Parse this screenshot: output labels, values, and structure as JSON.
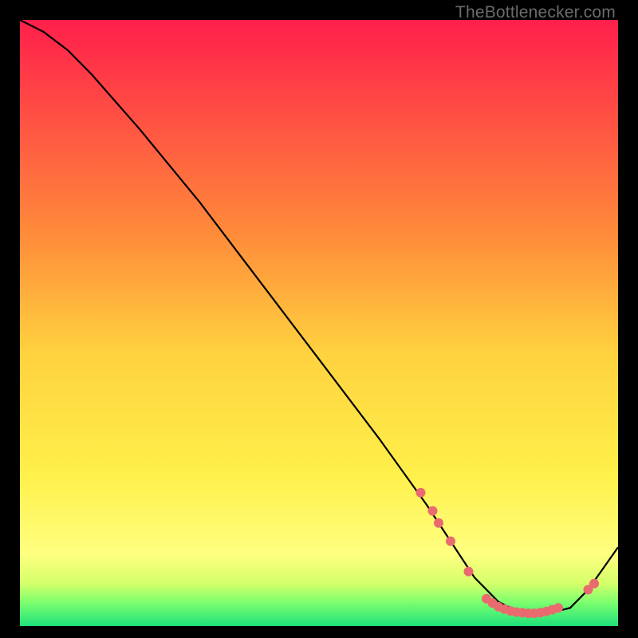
{
  "watermark": "TheBottlenecker.com",
  "chart_data": {
    "type": "line",
    "title": "",
    "xlabel": "",
    "ylabel": "",
    "xlim": [
      0,
      100
    ],
    "ylim": [
      0,
      100
    ],
    "grid": false,
    "background_gradient": {
      "stops": [
        {
          "offset": 0,
          "color": "#ff1f4b"
        },
        {
          "offset": 35,
          "color": "#ff8a3a"
        },
        {
          "offset": 55,
          "color": "#ffd23f"
        },
        {
          "offset": 75,
          "color": "#fff04a"
        },
        {
          "offset": 88,
          "color": "#ffff80"
        },
        {
          "offset": 93,
          "color": "#d4ff6a"
        },
        {
          "offset": 96,
          "color": "#7fff6e"
        },
        {
          "offset": 100,
          "color": "#1de27a"
        }
      ]
    },
    "series": [
      {
        "name": "bottleneck-curve",
        "x": [
          0,
          4,
          8,
          12,
          20,
          30,
          40,
          50,
          60,
          68,
          72,
          76,
          80,
          84,
          88,
          92,
          95,
          100
        ],
        "y": [
          100,
          98,
          95,
          91,
          82,
          70,
          57,
          44,
          31,
          20,
          14,
          8,
          4,
          2,
          2,
          3,
          6,
          13
        ]
      }
    ],
    "markers": {
      "name": "highlight-dots",
      "color": "#e96a6f",
      "points": [
        {
          "x": 67,
          "y": 22
        },
        {
          "x": 69,
          "y": 19
        },
        {
          "x": 70,
          "y": 17
        },
        {
          "x": 72,
          "y": 14
        },
        {
          "x": 75,
          "y": 9
        },
        {
          "x": 78,
          "y": 4.5
        },
        {
          "x": 79,
          "y": 3.8
        },
        {
          "x": 80,
          "y": 3.2
        },
        {
          "x": 81,
          "y": 2.8
        },
        {
          "x": 82,
          "y": 2.5
        },
        {
          "x": 83,
          "y": 2.3
        },
        {
          "x": 84,
          "y": 2.2
        },
        {
          "x": 85,
          "y": 2.1
        },
        {
          "x": 86,
          "y": 2.1
        },
        {
          "x": 87,
          "y": 2.2
        },
        {
          "x": 88,
          "y": 2.4
        },
        {
          "x": 89,
          "y": 2.7
        },
        {
          "x": 90,
          "y": 3.0
        },
        {
          "x": 95,
          "y": 6.0
        },
        {
          "x": 96,
          "y": 7.0
        }
      ]
    }
  }
}
